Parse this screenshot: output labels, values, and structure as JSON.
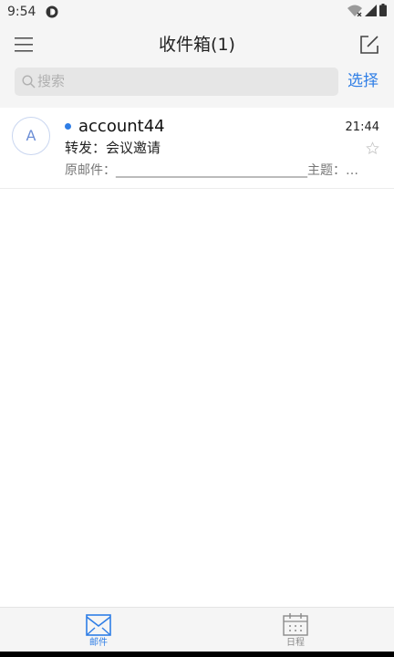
{
  "status_bar": {
    "time": "9:54",
    "icons": [
      "app-notification-icon",
      "wifi-icon",
      "signal-icon",
      "battery-icon"
    ]
  },
  "header": {
    "title": "收件箱(1)",
    "menu_icon": "hamburger-menu-icon",
    "compose_icon": "compose-icon"
  },
  "search": {
    "placeholder": "搜索",
    "select_label": "选择"
  },
  "mail_list": [
    {
      "avatar_letter": "A",
      "unread": true,
      "sender": "account44",
      "time": "21:44",
      "subject": "转发：会议邀请",
      "preview": "原邮件：______________________________主题：…",
      "starred": false
    }
  ],
  "tabs": [
    {
      "label": "邮件",
      "icon": "mail-icon",
      "active": true
    },
    {
      "label": "日程",
      "icon": "calendar-icon",
      "active": false
    }
  ],
  "colors": {
    "accent": "#2f7ee6",
    "header_bg": "#f5f5f5",
    "search_bg": "#e6e6e6",
    "muted_text": "#777777"
  }
}
